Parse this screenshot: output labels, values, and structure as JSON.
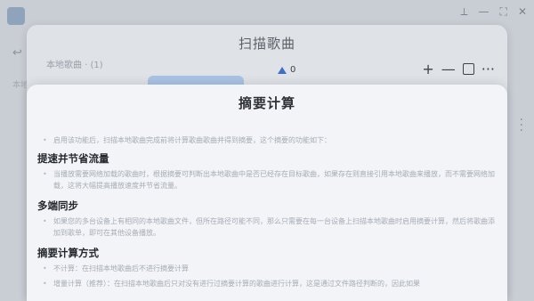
{
  "app": {
    "window_controls": [
      "⟂",
      "—",
      "⛶",
      "✕"
    ],
    "side_mark": "↩",
    "side_text": "本地"
  },
  "scan_dialog": {
    "title": "扫描歌曲",
    "faded_label": "本地歌曲 · (1)",
    "count": "0",
    "toolbar": {
      "add": "+",
      "remove": "—",
      "more": "···"
    }
  },
  "summary_dialog": {
    "title": "摘要计算",
    "intro": "启用该功能后，扫描本地歌曲完成前将计算歌曲歌曲并得到摘要，这个摘要的功能如下：",
    "sections": [
      {
        "heading": "提速并节省流量",
        "bullets": [
          "当播放需要网络加载的歌曲时，根据摘要可判断出本地歌曲中是否已经存在目标歌曲，如果存在则直接引用本地歌曲来播放，而不需要网络加载，这将大幅提高播放速度并节省流量。"
        ]
      },
      {
        "heading": "多端同步",
        "bullets": [
          "如果您的多台设备上有相同的本地歌曲文件，但所在路径可能不同，那么只需要在每一台设备上扫描本地歌曲时启用摘要计算，然后将歌曲添加到歌单，即可在其他设备播放。"
        ]
      },
      {
        "heading": "摘要计算方式",
        "bullets": [
          "不计算：在扫描本地歌曲后不进行摘要计算",
          "增量计算（推荐）：在扫描本地歌曲后只对没有进行过摘要计算的歌曲进行计算，这是通过文件路径判断的，因此如果"
        ]
      }
    ]
  }
}
